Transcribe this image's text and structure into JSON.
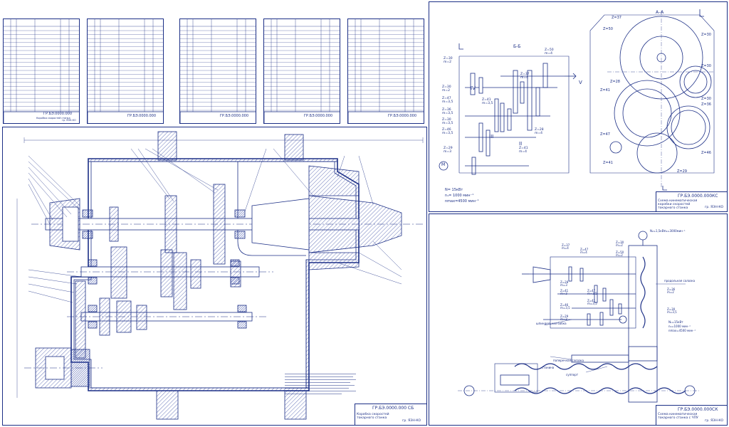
{
  "colors": {
    "ink": "#1c2f86",
    "hatch": "#2a3f9e",
    "paper": "#ffffff"
  },
  "spec_sheets": [
    {
      "code": "ГР.БЭ.0000.000",
      "sub": "Коробка скоростей станка",
      "group": "гр. ЯЭН-КО"
    },
    {
      "code": "ГР.БЭ.0000.000",
      "sub": "",
      "group": ""
    },
    {
      "code": "ГР.БЭ.0000.000",
      "sub": "",
      "group": ""
    },
    {
      "code": "ГР.БЭ.0000.000",
      "sub": "",
      "group": ""
    },
    {
      "code": "ГР.БЭ.0000.000",
      "sub": "",
      "group": ""
    }
  ],
  "main_drawing": {
    "stamp_code": "ГР.БЭ.0000.000 СБ",
    "stamp_title": "Коробка скоростей токарного станка",
    "stamp_group": "гр. ЯЭН-КО"
  },
  "kinematic": {
    "section_bb": "Б-Б",
    "section_aa": "А–А",
    "shafts": [
      "I",
      "II",
      "III",
      "IV",
      "V"
    ],
    "gear_labels": [
      "Z=30\nm=2",
      "Z=50\nm=4",
      "Z=30\nm=2",
      "Z=47\nm=3,5",
      "Z=41\nm=3,5",
      "Z=36\nm=3,5",
      "Z=30\nm=3,5",
      "Z=46\nm=3,5",
      "Z=29\nm=3",
      "Z=37\nm=4",
      "Z=28\nm=4",
      "Z=41\nm=4"
    ],
    "motor": "M",
    "motor_specs": [
      "N= 15кВт",
      "n₁= 1000 мин⁻¹",
      "nmax=4500 мин⁻¹"
    ],
    "aa_labels": [
      "Z=37",
      "Z=50",
      "Z=30",
      "Z=30",
      "Z=28",
      "Z=41",
      "Z=47",
      "Z=41",
      "Z=30",
      "Z=36",
      "Z=46",
      "Z=29"
    ],
    "stamp_code": "ГР.БЭ.0000.000КС",
    "stamp_title": "Схема кинематическая коробки скоростей токарного станка",
    "stamp_group": "гр. ЯЭН-КО"
  },
  "scheme": {
    "labels": [
      "продольная салазка",
      "поперечная салазка",
      "суппорт",
      "шпиндельная бабка",
      "станина"
    ],
    "gear_labels": [
      "Z=37\nm=4",
      "Z=47\nm=4",
      "Z=28\nm=3",
      "Z=41\nm=3",
      "Z=47\nm=3,5",
      "Z=41\nm=3,5",
      "Z=46\nm=3,5",
      "Z=29\nm=3",
      "Z=30\nm=2",
      "Z=50\nm=2",
      "Z=36\nm=2",
      "Z=30\nm=3,5"
    ],
    "motor_specs": [
      "N₁=15кВт",
      "n₁=1000 мин⁻¹",
      "nmax=4500 мин⁻¹"
    ],
    "servo": [
      "N₂=1,5кВт",
      "n₂=3000мин⁻¹"
    ],
    "stamp_code": "ГР.БЭ.0000.000СК",
    "stamp_title": "Схема кинематическая токарного станка с ЧПУ",
    "stamp_group": "гр. ЯЭН-КО"
  }
}
